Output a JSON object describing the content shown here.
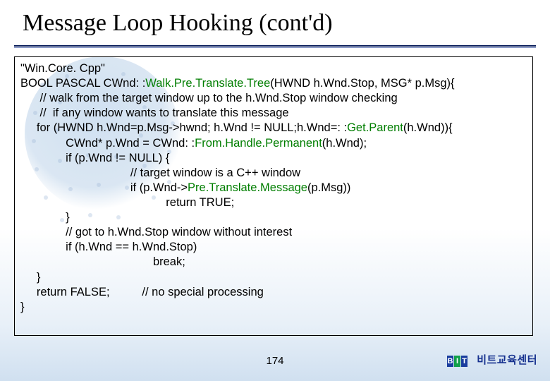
{
  "title": "Message Loop Hooking (cont'd)",
  "code": {
    "l1": "\"Win.Core. Cpp\"",
    "l2a": "BOOL PASCAL CWnd: :",
    "l2fn": "Walk.Pre.Translate.Tree",
    "l2b": "(HWND h.Wnd.Stop, MSG* p.Msg){",
    "l3": "      // walk from the target window up to the h.Wnd.Stop window checking",
    "l4": "      //  if any window wants to translate this message",
    "l5a": "     for (HWND h.Wnd=p.Msg->hwnd; h.Wnd != NULL;h.Wnd=: :",
    "l5fn": "Get.Parent",
    "l5b": "(h.Wnd)){",
    "l6a": "              CWnd* p.Wnd = CWnd: :",
    "l6fn": "From.Handle.Permanent",
    "l6b": "(h.Wnd);",
    "l7": "              if (p.Wnd != NULL) {",
    "l8": "                                  // target window is a C++ window",
    "l9a": "                                  if (p.Wnd->",
    "l9fn": "Pre.Translate.Message",
    "l9b": "(p.Msg))",
    "l10": "                                             return TRUE;",
    "l11": "              }",
    "l12": "              // got to h.Wnd.Stop window without interest",
    "l13": "              if (h.Wnd == h.Wnd.Stop)",
    "l14": "                                         break;",
    "l15": "     }",
    "l16": "     return FALSE;          // no special processing",
    "l17": "}"
  },
  "page_number": "174",
  "logo": {
    "b": "B",
    "i": "I",
    "t": "T"
  },
  "footer_label": "비트교육센터"
}
